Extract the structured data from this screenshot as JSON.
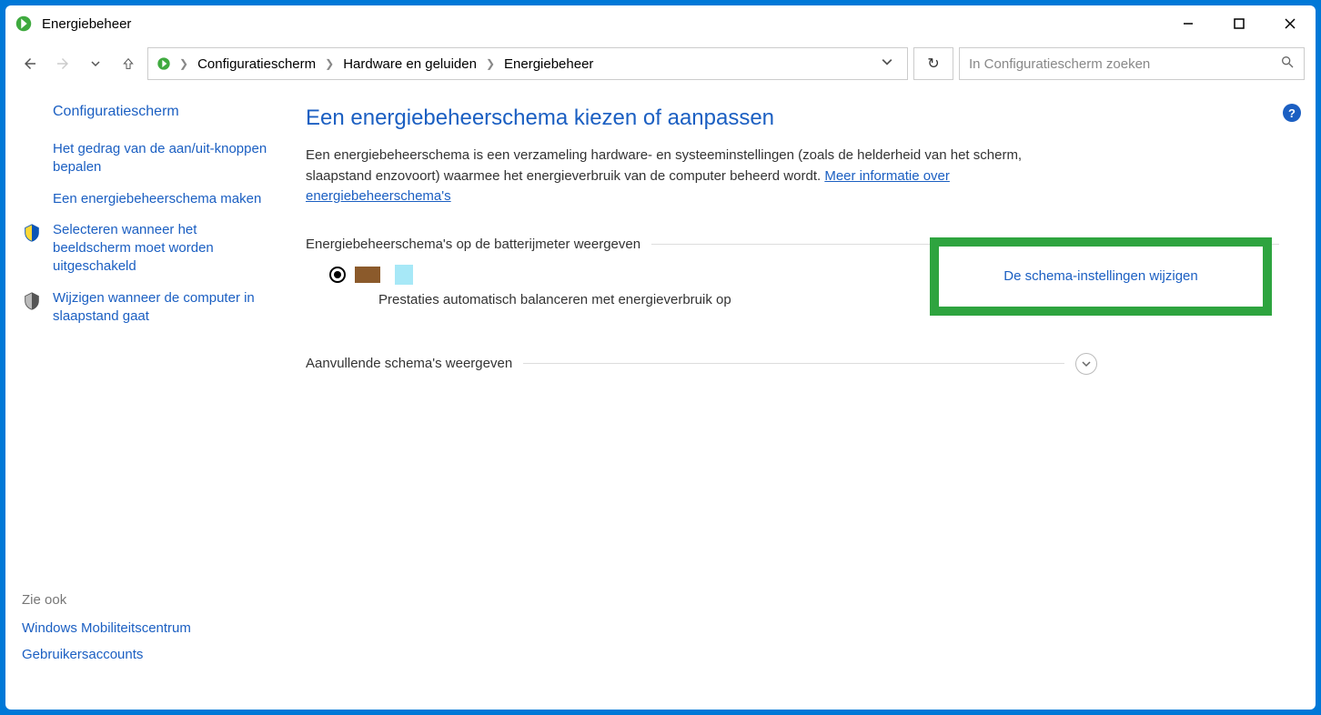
{
  "window": {
    "title": "Energiebeheer"
  },
  "breadcrumbs": {
    "items": [
      "Configuratiescherm",
      "Hardware en geluiden",
      "Energiebeheer"
    ]
  },
  "search": {
    "placeholder": "In Configuratiescherm zoeken"
  },
  "sidebar": {
    "heading": "Configuratiescherm",
    "links": [
      "Het gedrag van de aan/uit-knoppen bepalen",
      "Een energiebeheerschema maken",
      "Selecteren wanneer het beeldscherm moet worden uitgeschakeld",
      "Wijzigen wanneer de computer in slaapstand gaat"
    ],
    "see_also_label": "Zie ook",
    "see_also": [
      "Windows Mobiliteitscentrum",
      "Gebruikersaccounts"
    ]
  },
  "main": {
    "heading": "Een energiebeheerschema kiezen of aanpassen",
    "description": "Een energiebeheerschema is een verzameling hardware- en systeeminstellingen (zoals de helderheid van het scherm, slaapstand enzovoort) waarmee het energieverbruik van de computer beheerd wordt. ",
    "more_link": "Meer informatie over energiebeheerschema's",
    "section_label": "Energiebeheerschema's op de batterijmeter weergeven",
    "plan_description": "Prestaties automatisch balanceren met energieverbruik op",
    "change_settings_link": "De schema-instellingen wijzigen",
    "expand_label": "Aanvullende schema's weergeven"
  }
}
